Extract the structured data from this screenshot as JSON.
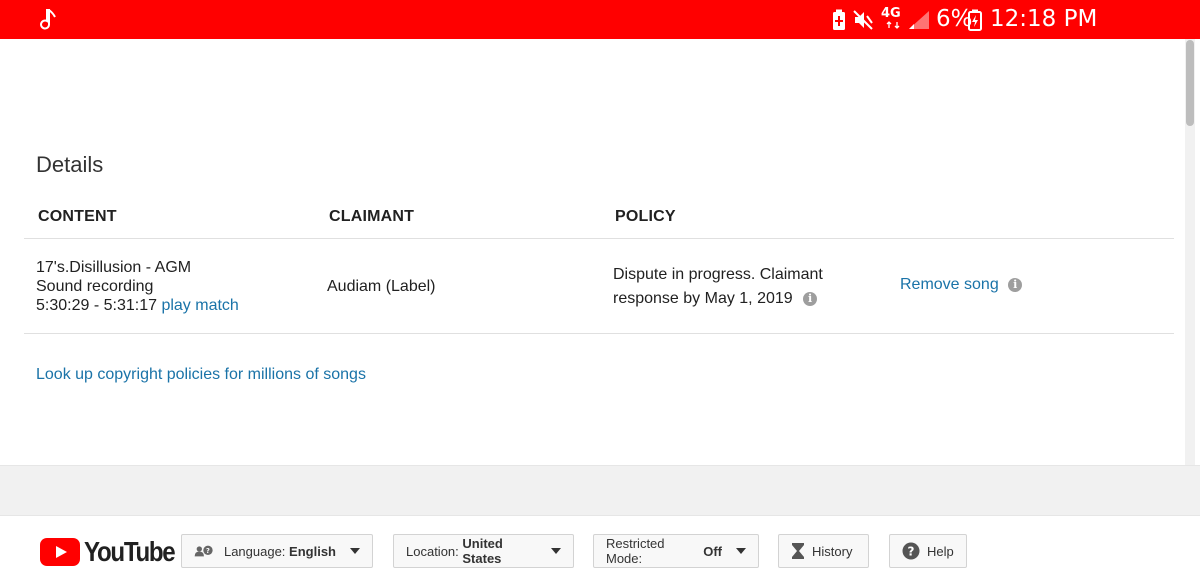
{
  "status_bar": {
    "battery_percent": "6%",
    "time": "12:18 PM",
    "network": "4G",
    "icons": [
      "music-note-icon",
      "battery-saver-icon",
      "mute-icon",
      "lte-icon",
      "signal-icon",
      "battery-icon"
    ]
  },
  "details": {
    "title": "Details",
    "columns": [
      "CONTENT",
      "CLAIMANT",
      "POLICY"
    ],
    "row": {
      "song_title": "17's.Disillusion - AGM",
      "content_type": "Sound recording",
      "time_range": "5:30:29 - 5:31:17",
      "play_match": "play match",
      "claimant": "Audiam (Label)",
      "policy_line1": "Dispute in progress. Claimant",
      "policy_line2": "response by May 1, 2019",
      "action": "Remove song"
    },
    "lookup_link": "Look up copyright policies for millions of songs"
  },
  "footer": {
    "logo_text": "YouTube",
    "language_label": "Language:",
    "language_value": "English",
    "location_label": "Location:",
    "location_value": "United States",
    "restricted_label": "Restricted Mode:",
    "restricted_value": "Off",
    "history": "History",
    "help": "Help"
  },
  "colors": {
    "status_bar": "#ff0000",
    "link": "#1a73a8",
    "logo_red": "#ff0000"
  }
}
